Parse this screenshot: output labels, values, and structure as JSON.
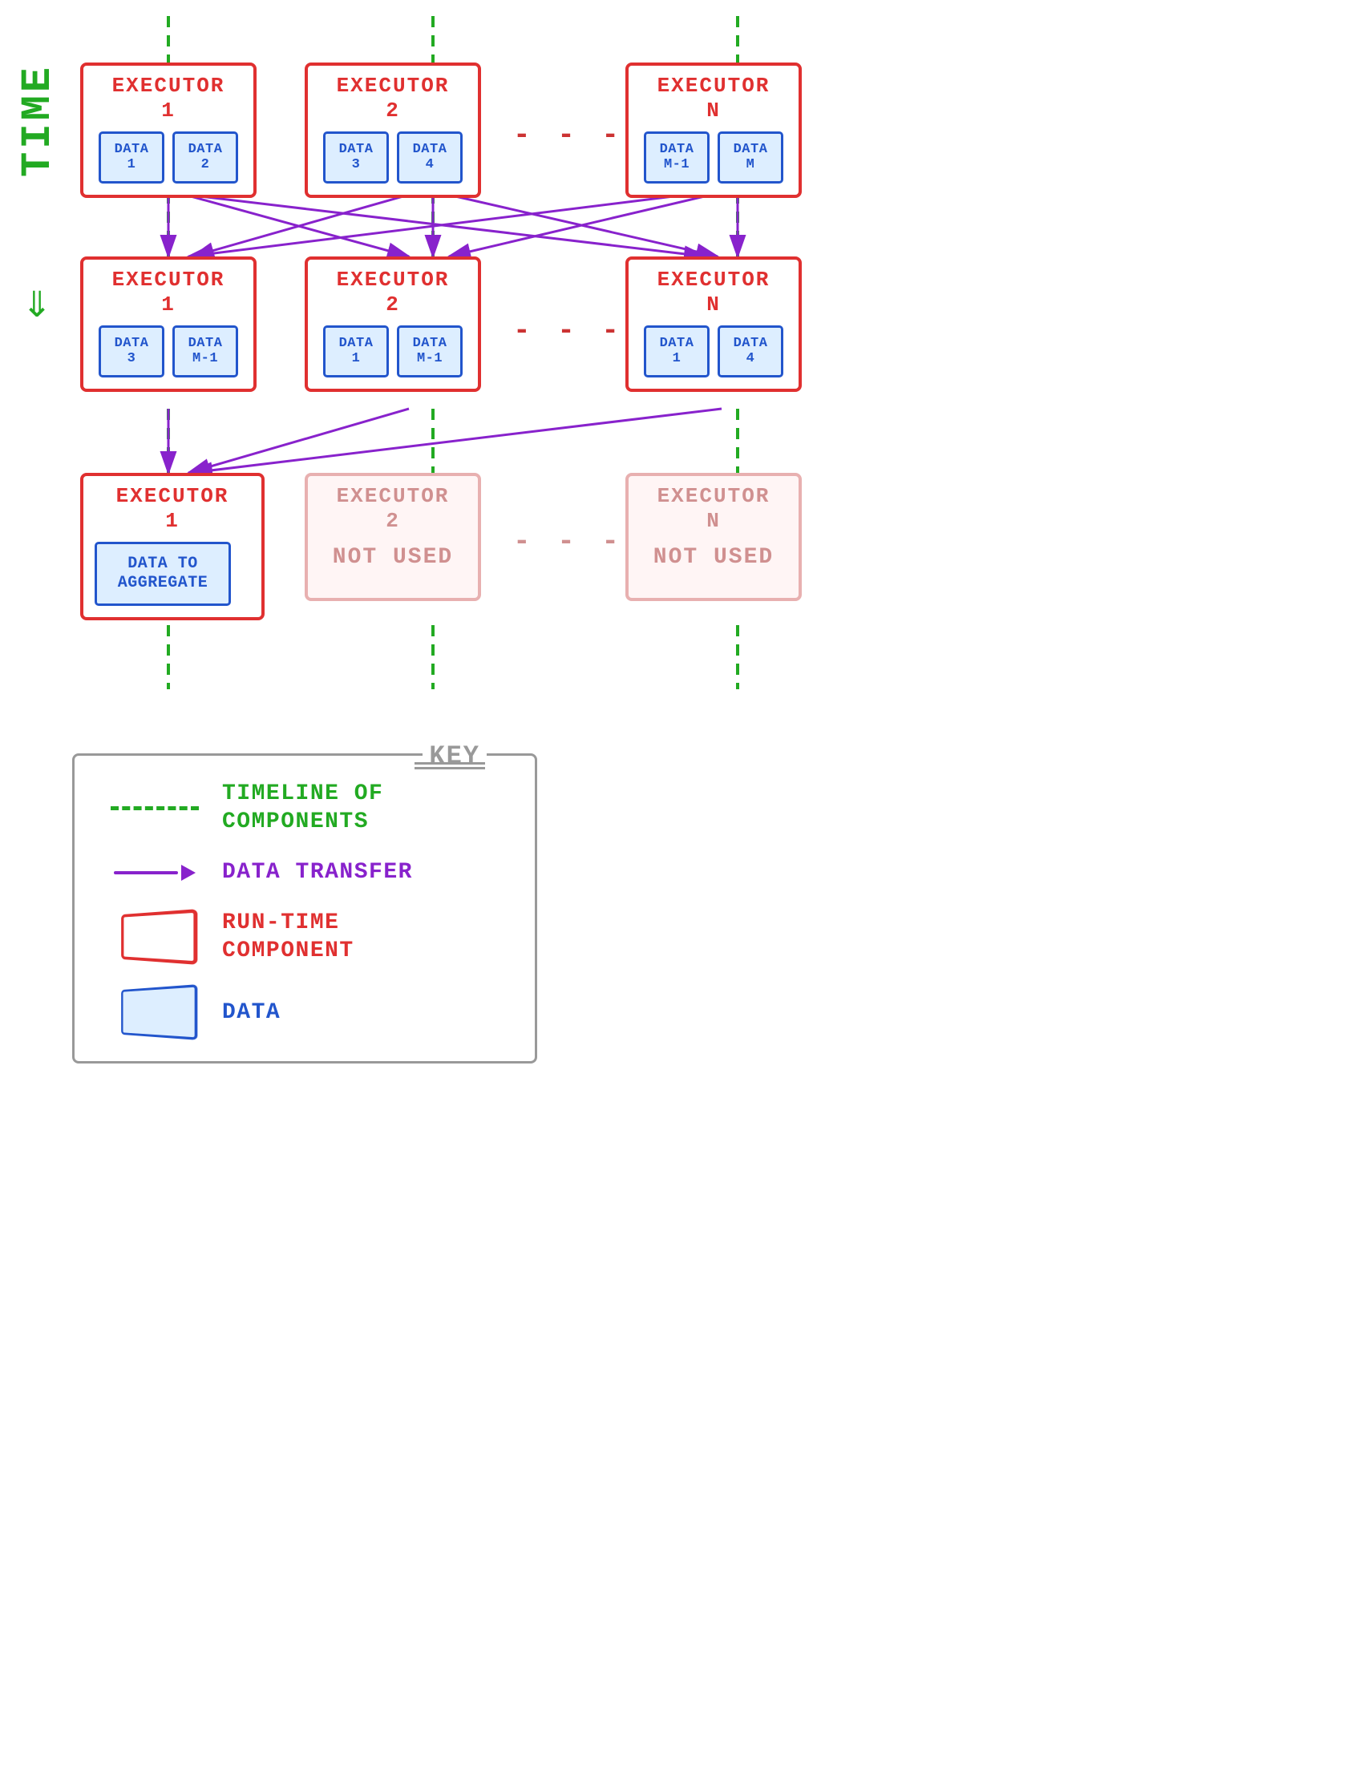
{
  "time_label": "TIME",
  "row1": {
    "executor1": {
      "title": "EXECUTOR\n1",
      "data": [
        {
          "label": "DATA\n1"
        },
        {
          "label": "DATA\n2"
        }
      ]
    },
    "executor2": {
      "title": "EXECUTOR\n2",
      "data": [
        {
          "label": "DATA\n3"
        },
        {
          "label": "DATA\n4"
        }
      ]
    },
    "executorN": {
      "title": "EXECUTOR\nN",
      "data": [
        {
          "label": "DATA\nM-1"
        },
        {
          "label": "DATA\nM"
        }
      ]
    }
  },
  "row2": {
    "executor1": {
      "title": "EXECUTOR\n1",
      "data": [
        {
          "label": "DATA\n3"
        },
        {
          "label": "DATA\nM-1"
        }
      ]
    },
    "executor2": {
      "title": "EXECUTOR\n2",
      "data": [
        {
          "label": "DATA\n1"
        },
        {
          "label": "DATA\nM-1"
        }
      ]
    },
    "executorN": {
      "title": "EXECUTOR\nN",
      "data": [
        {
          "label": "DATA\n1"
        },
        {
          "label": "DATA\n4"
        }
      ]
    }
  },
  "row3": {
    "executor1": {
      "title": "EXECUTOR\n1",
      "data_large": "DATA TO\nAGGREGATE"
    },
    "executor2": {
      "title": "EXECUTOR\n2",
      "not_used": "NOT USED"
    },
    "executorN": {
      "title": "EXECUTOR\nN",
      "not_used": "NOT USED"
    }
  },
  "dots": "- - - -",
  "key": {
    "title": "KEY",
    "items": [
      {
        "symbol": "dashed",
        "desc": "TIMELINE OF\nCOMPONENTS",
        "color": "green"
      },
      {
        "symbol": "arrow",
        "desc": "DATA TRANSFER",
        "color": "purple"
      },
      {
        "symbol": "red-box",
        "desc": "RUN-TIME\nCOMPONENT",
        "color": "red"
      },
      {
        "symbol": "blue-box",
        "desc": "DATA",
        "color": "blue"
      }
    ]
  }
}
